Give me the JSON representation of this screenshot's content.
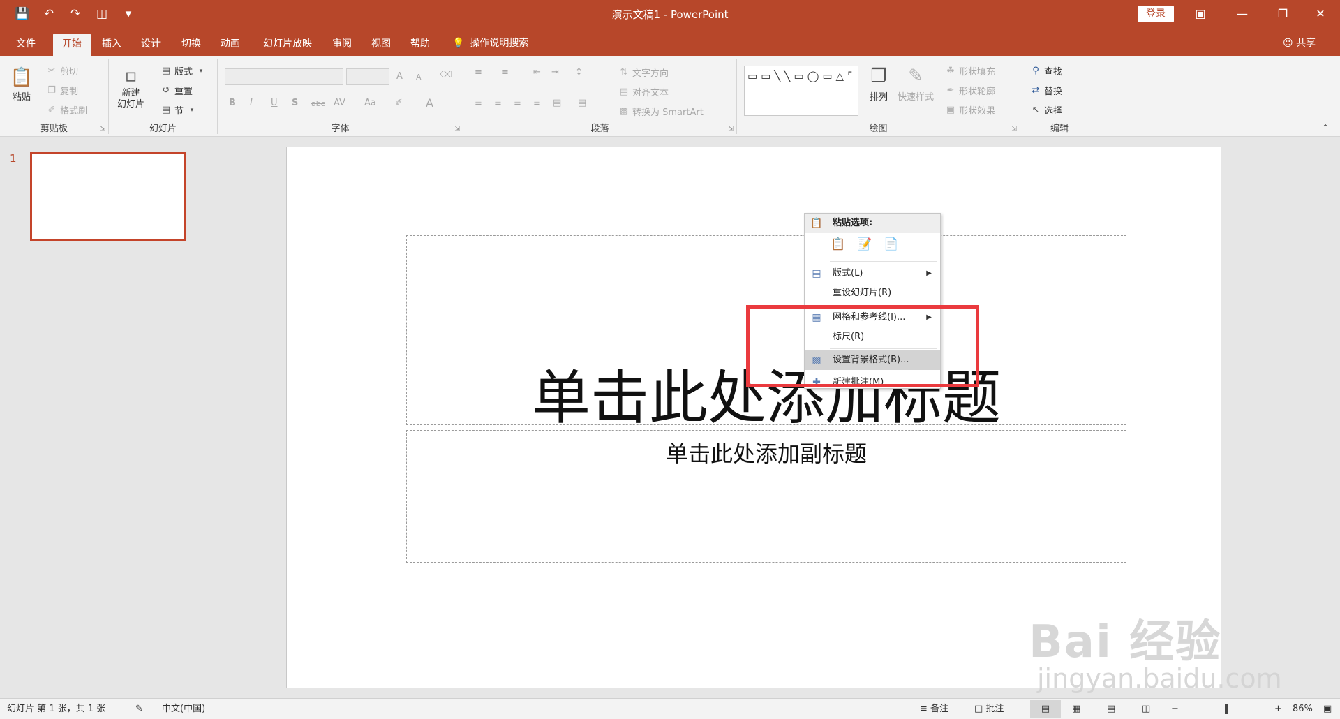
{
  "titlebar": {
    "title": "演示文稿1  -  PowerPoint",
    "login_label": "登录"
  },
  "tabs": [
    "文件",
    "开始",
    "插入",
    "设计",
    "切换",
    "动画",
    "幻灯片放映",
    "审阅",
    "视图",
    "帮助"
  ],
  "active_tab": "开始",
  "tell_me": "操作说明搜索",
  "share": "共享",
  "ribbon": {
    "clipboard": {
      "paste": "粘贴",
      "cut": "剪切",
      "copy": "复制",
      "format_painter": "格式刷",
      "label": "剪贴板"
    },
    "slides": {
      "new_slide_1": "新建",
      "new_slide_2": "幻灯片",
      "layout": "版式",
      "reset": "重置",
      "section": "节",
      "label": "幻灯片"
    },
    "font": {
      "label": "字体",
      "bold": "B",
      "italic": "I",
      "underline": "U",
      "shadow": "S",
      "strike": "abc",
      "spacing": "AV",
      "case": "Aa",
      "grow": "A",
      "shrink": "A"
    },
    "paragraph": {
      "text_direction": "文字方向",
      "align_text": "对齐文本",
      "smartart": "转换为 SmartArt",
      "label": "段落"
    },
    "drawing": {
      "arrange": "排列",
      "quick_styles": "快速样式",
      "shape_fill": "形状填充",
      "shape_outline": "形状轮廓",
      "shape_effects": "形状效果",
      "label": "绘图"
    },
    "editing": {
      "find": "查找",
      "replace": "替换",
      "select": "选择",
      "label": "编辑"
    }
  },
  "thumbnail": {
    "number": "1"
  },
  "slide": {
    "title_placeholder": "单击此处添加标题",
    "subtitle_placeholder": "单击此处添加副标题"
  },
  "context_menu": {
    "header": "粘贴选项:",
    "items": [
      {
        "label": "版式(L)",
        "submenu": true
      },
      {
        "label": "重设幻灯片(R)",
        "submenu": false
      },
      {
        "label": "网格和参考线(I)...",
        "submenu": true
      },
      {
        "label": "标尺(R)",
        "submenu": false
      },
      {
        "label": "设置背景格式(B)...",
        "submenu": false,
        "highlighted": true
      },
      {
        "label": "新建批注(M)",
        "submenu": false
      }
    ]
  },
  "watermark": {
    "main": "Bai 经验",
    "sub": "jingyan.baidu.com"
  },
  "statusbar": {
    "slide_info": "幻灯片 第 1 张，共 1 张",
    "language": "中文(中国)",
    "notes": "备注",
    "comments": "批注",
    "zoom_minus": "−",
    "zoom_plus": "+",
    "zoom": "86%",
    "zoom_fraction": 0.5
  },
  "colors": {
    "accent": "#b7472a",
    "highlight_box": "#ea3a3e"
  }
}
